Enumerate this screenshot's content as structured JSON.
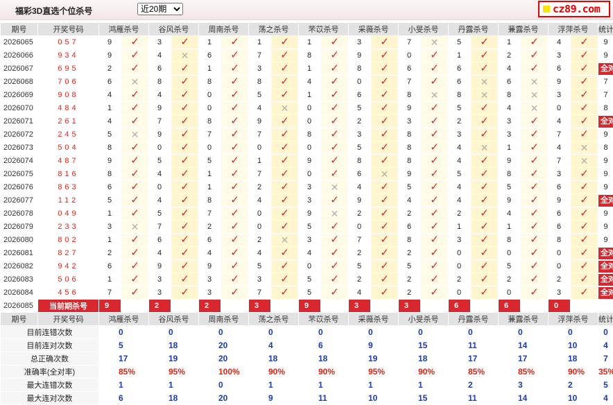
{
  "header": {
    "title": "福彩3D直选个位杀号",
    "period_selected": "近20期",
    "logo_text": "cz89.com"
  },
  "columns": {
    "issue": "期号",
    "draw": "开奖号码",
    "methods": [
      "鸿雁杀号",
      "谷风杀号",
      "周南杀号",
      "荡之杀号",
      "芣苡杀号",
      "采薇杀号",
      "小旻杀号",
      "丹露杀号",
      "蒹露杀号",
      "浮萍杀号"
    ],
    "tally": "统计"
  },
  "rows": [
    {
      "issue": "2026065",
      "draw": "057",
      "kills": [
        9,
        3,
        1,
        1,
        1,
        3,
        7,
        5,
        1,
        4
      ],
      "hits": [
        1,
        1,
        1,
        1,
        1,
        1,
        0,
        1,
        1,
        1
      ],
      "tally": "9"
    },
    {
      "issue": "2026066",
      "draw": "934",
      "kills": [
        9,
        4,
        6,
        7,
        8,
        9,
        0,
        1,
        2,
        3
      ],
      "hits": [
        1,
        0,
        1,
        1,
        1,
        1,
        1,
        1,
        1,
        1
      ],
      "tally": "9"
    },
    {
      "issue": "2026067",
      "draw": "695",
      "kills": [
        2,
        6,
        1,
        3,
        1,
        8,
        6,
        6,
        4,
        6
      ],
      "hits": [
        1,
        1,
        1,
        1,
        1,
        1,
        1,
        1,
        1,
        1
      ],
      "tally": "全对"
    },
    {
      "issue": "2026068",
      "draw": "706",
      "kills": [
        6,
        8,
        8,
        8,
        4,
        0,
        7,
        6,
        6,
        9
      ],
      "hits": [
        0,
        1,
        1,
        1,
        1,
        1,
        1,
        0,
        0,
        1
      ],
      "tally": "7"
    },
    {
      "issue": "2026069",
      "draw": "908",
      "kills": [
        4,
        4,
        0,
        5,
        1,
        6,
        8,
        8,
        8,
        3
      ],
      "hits": [
        1,
        1,
        1,
        1,
        1,
        1,
        0,
        0,
        0,
        1
      ],
      "tally": "7"
    },
    {
      "issue": "2026070",
      "draw": "484",
      "kills": [
        1,
        9,
        0,
        4,
        0,
        5,
        9,
        5,
        4,
        0
      ],
      "hits": [
        1,
        1,
        1,
        0,
        1,
        1,
        1,
        1,
        0,
        1
      ],
      "tally": "8"
    },
    {
      "issue": "2026071",
      "draw": "261",
      "kills": [
        4,
        7,
        8,
        9,
        0,
        2,
        3,
        2,
        3,
        4
      ],
      "hits": [
        1,
        1,
        1,
        1,
        1,
        1,
        1,
        1,
        1,
        1
      ],
      "tally": "全对"
    },
    {
      "issue": "2026072",
      "draw": "245",
      "kills": [
        5,
        9,
        7,
        7,
        8,
        3,
        8,
        3,
        3,
        7
      ],
      "hits": [
        0,
        1,
        1,
        1,
        1,
        1,
        1,
        1,
        1,
        1
      ],
      "tally": "9"
    },
    {
      "issue": "2026073",
      "draw": "504",
      "kills": [
        8,
        0,
        0,
        0,
        0,
        5,
        8,
        4,
        1,
        4
      ],
      "hits": [
        1,
        1,
        1,
        1,
        1,
        1,
        1,
        0,
        1,
        0
      ],
      "tally": "8"
    },
    {
      "issue": "2026074",
      "draw": "487",
      "kills": [
        9,
        5,
        5,
        1,
        9,
        8,
        8,
        4,
        9,
        7
      ],
      "hits": [
        1,
        1,
        1,
        1,
        1,
        1,
        1,
        1,
        1,
        0
      ],
      "tally": "9"
    },
    {
      "issue": "2026075",
      "draw": "816",
      "kills": [
        8,
        4,
        1,
        7,
        0,
        6,
        9,
        5,
        8,
        3
      ],
      "hits": [
        1,
        1,
        1,
        1,
        1,
        0,
        1,
        1,
        1,
        1
      ],
      "tally": "9"
    },
    {
      "issue": "2026076",
      "draw": "863",
      "kills": [
        6,
        0,
        1,
        2,
        3,
        4,
        5,
        4,
        5,
        6
      ],
      "hits": [
        1,
        1,
        1,
        1,
        0,
        1,
        1,
        1,
        1,
        1
      ],
      "tally": "9"
    },
    {
      "issue": "2026077",
      "draw": "112",
      "kills": [
        5,
        4,
        8,
        4,
        3,
        9,
        4,
        4,
        9,
        9
      ],
      "hits": [
        1,
        1,
        1,
        1,
        1,
        1,
        1,
        1,
        1,
        1
      ],
      "tally": "全对"
    },
    {
      "issue": "2026078",
      "draw": "049",
      "kills": [
        1,
        5,
        7,
        0,
        9,
        2,
        2,
        2,
        4,
        6
      ],
      "hits": [
        1,
        1,
        1,
        1,
        0,
        1,
        1,
        1,
        1,
        1
      ],
      "tally": "9"
    },
    {
      "issue": "2026079",
      "draw": "233",
      "kills": [
        3,
        7,
        2,
        0,
        5,
        0,
        6,
        1,
        1,
        6
      ],
      "hits": [
        0,
        1,
        1,
        1,
        1,
        1,
        1,
        1,
        1,
        1
      ],
      "tally": "9"
    },
    {
      "issue": "2026080",
      "draw": "802",
      "kills": [
        1,
        6,
        6,
        2,
        3,
        7,
        8,
        3,
        8,
        8
      ],
      "hits": [
        1,
        1,
        1,
        0,
        1,
        1,
        1,
        1,
        1,
        1
      ],
      "tally": "9"
    },
    {
      "issue": "2026081",
      "draw": "827",
      "kills": [
        2,
        4,
        4,
        4,
        4,
        2,
        2,
        0,
        0,
        0
      ],
      "hits": [
        1,
        1,
        1,
        1,
        1,
        1,
        1,
        1,
        1,
        1
      ],
      "tally": "全对"
    },
    {
      "issue": "2026082",
      "draw": "942",
      "kills": [
        6,
        9,
        9,
        5,
        0,
        5,
        5,
        0,
        5,
        0
      ],
      "hits": [
        1,
        1,
        1,
        1,
        1,
        1,
        1,
        1,
        1,
        1
      ],
      "tally": "全对"
    },
    {
      "issue": "2026083",
      "draw": "506",
      "kills": [
        1,
        3,
        3,
        3,
        5,
        2,
        2,
        2,
        2,
        2
      ],
      "hits": [
        1,
        1,
        1,
        1,
        1,
        1,
        1,
        1,
        1,
        1
      ],
      "tally": "全对"
    },
    {
      "issue": "2026084",
      "draw": "456",
      "kills": [
        7,
        3,
        3,
        7,
        5,
        4,
        2,
        0,
        0,
        3
      ],
      "hits": [
        1,
        1,
        1,
        1,
        1,
        1,
        1,
        1,
        1,
        1
      ],
      "tally": "全对"
    }
  ],
  "current": {
    "issue": "2026085",
    "label": "当前期杀号",
    "kills": [
      "9",
      "2",
      "2",
      "3",
      "9",
      "3",
      "3",
      "6",
      "6",
      "0"
    ]
  },
  "stats": [
    {
      "label": "目前连错次数",
      "values": [
        "0",
        "0",
        "0",
        "0",
        "0",
        "0",
        "0",
        "0",
        "0",
        "0"
      ],
      "tally": "0",
      "pct": false
    },
    {
      "label": "目前连对次数",
      "values": [
        "5",
        "18",
        "20",
        "4",
        "6",
        "9",
        "15",
        "11",
        "14",
        "10"
      ],
      "tally": "4",
      "pct": false
    },
    {
      "label": "总正确次数",
      "values": [
        "17",
        "19",
        "20",
        "18",
        "18",
        "19",
        "18",
        "17",
        "17",
        "18"
      ],
      "tally": "7",
      "pct": false
    },
    {
      "label": "准确率(全对率)",
      "values": [
        "85%",
        "95%",
        "100%",
        "90%",
        "90%",
        "95%",
        "90%",
        "85%",
        "85%",
        "90%"
      ],
      "tally": "35%",
      "pct": true
    },
    {
      "label": "最大连错次数",
      "values": [
        "1",
        "1",
        "0",
        "1",
        "1",
        "1",
        "1",
        "2",
        "3",
        "2"
      ],
      "tally": "5",
      "pct": false
    },
    {
      "label": "最大连对次数",
      "values": [
        "6",
        "18",
        "20",
        "9",
        "11",
        "10",
        "15",
        "11",
        "14",
        "10"
      ],
      "tally": "4",
      "pct": false
    }
  ],
  "icons": {
    "hit": "check-mark-icon",
    "miss": "cross-mark-icon"
  },
  "colors": {
    "accent": "#d8282e",
    "draw_digits": "#d8281b",
    "stat_blue": "#1a3ab0",
    "header_gray": "#e2e2e2"
  }
}
